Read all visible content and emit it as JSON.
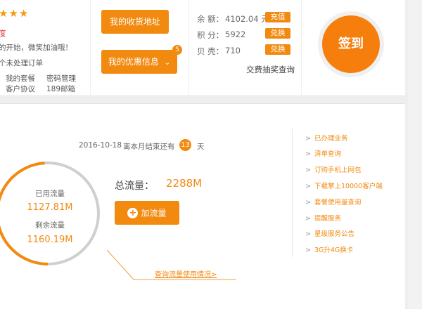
{
  "profile": {
    "stars": "★★★",
    "red_char": "度",
    "slogan": "的开始，微笑加油哦！",
    "pending_orders": "个未处理订单",
    "links": [
      "我的套餐",
      "密码管理",
      "客户协议",
      "189邮箱"
    ]
  },
  "actions": {
    "address_btn": "我的收货地址",
    "coupon_btn": "我的优惠信息",
    "coupon_chevron": "chevron-down-icon",
    "coupon_badge": "5"
  },
  "balances": {
    "rows": [
      {
        "label": "余  额：",
        "value": "4102.04 元",
        "button": "充值"
      },
      {
        "label": "积  分：",
        "value": "5922",
        "button": "兑换"
      },
      {
        "label": "贝  壳：",
        "value": "710",
        "button": "兑换"
      }
    ],
    "lottery_link": "交费抽奖查询"
  },
  "signin": {
    "label": "签到"
  },
  "usage": {
    "date": "2016-10-18",
    "month_end_prefix": "离本月结束还有",
    "days_left": "13",
    "days_unit": "天",
    "used_label": "已用流量",
    "used_value": "1127.81M",
    "remaining_label": "剩余流量",
    "remaining_value": "1160.19M",
    "used_fraction": 0.49,
    "total_label": "总流量：",
    "total_value": "2288M",
    "add_button": "加流量",
    "query_link": "查询流量使用情况>"
  },
  "sidebar": {
    "items": [
      "已办理业务",
      "清单查询",
      "订购手机上网包",
      "下载掌上10000客户端",
      "套餐使用量查询",
      "提醒服务",
      "星级服务公告",
      "3G升4G换卡"
    ]
  },
  "colors": {
    "accent": "#f28a10",
    "ring_track": "#cfcfcf"
  }
}
